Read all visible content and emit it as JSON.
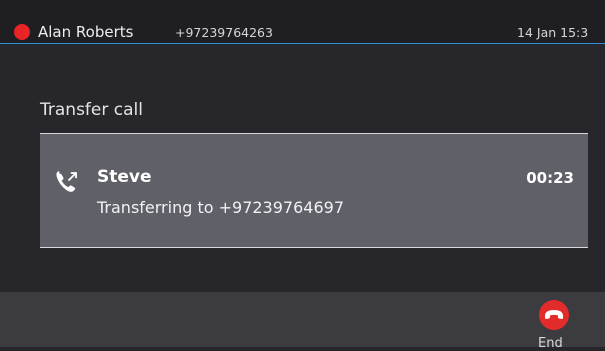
{
  "status_bar": {
    "user_name": "Alan Roberts",
    "user_number": "+97239764263",
    "datetime": "14 Jan 15:3",
    "presence_color": "#e82424",
    "accent_color": "#2f8fd0"
  },
  "screen": {
    "title": "Transfer call"
  },
  "call": {
    "icon": "phone-transfer-icon",
    "contact_name": "Steve",
    "status": "Transferring to +97239764697",
    "timer": "00:23"
  },
  "softkeys": [
    {
      "label": "End",
      "icon": "end-call-icon",
      "color": "#e22b2b"
    }
  ]
}
